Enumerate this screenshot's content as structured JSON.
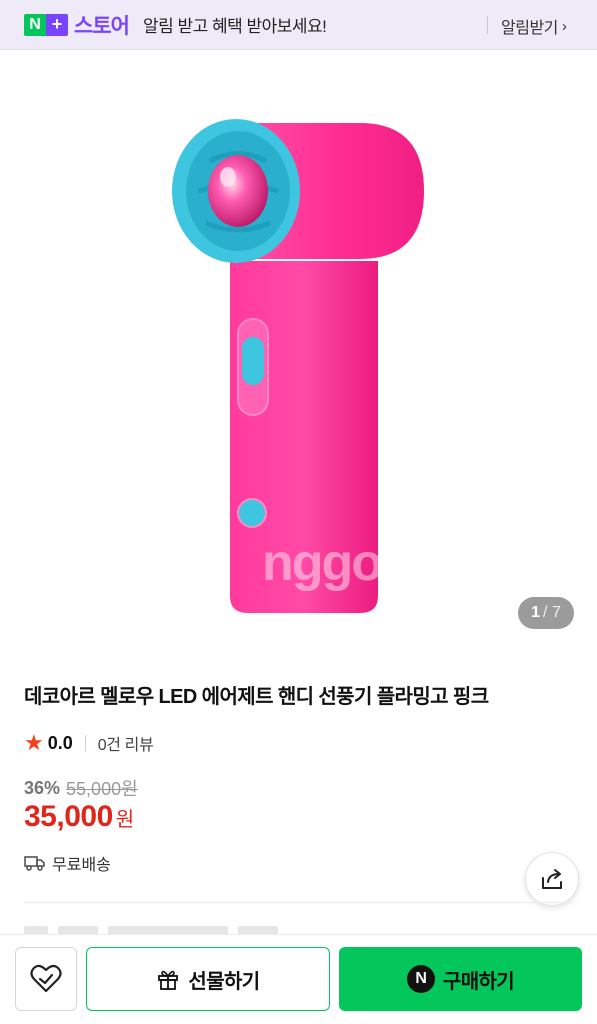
{
  "banner": {
    "logo_n": "N",
    "logo_plus": "+",
    "logo_text": "스토어",
    "message": "알림 받고 혜택 받아보세요!",
    "link_label": "알림받기",
    "chevron": "›",
    "brand_purple": "#7a44ff",
    "brand_green": "#03c75a"
  },
  "gallery": {
    "watermark": "nggon",
    "current_page": "1",
    "total_pages": "/ 7",
    "product_colors": {
      "body": "#ff2d92",
      "ring": "#3ec6e0",
      "center": "#ff3aa0"
    }
  },
  "product": {
    "title": "데코아르 멜로우 LED 에어제트 핸디 선풍기 플라밍고 핑크",
    "rating_icon": "star-icon",
    "rating": "0.0",
    "review_count": "0건 리뷰",
    "discount": "36%",
    "original_price": "55,000원",
    "price": "35,000",
    "price_unit": "원",
    "shipping": "무료배송",
    "accent_red": "#e1251b"
  },
  "actions": {
    "share_icon": "share-icon",
    "like_icon": "heart-icon",
    "gift_label": "선물하기",
    "gift_icon": "gift-icon",
    "buy_label": "구매하기",
    "buy_icon_letter": "N"
  }
}
